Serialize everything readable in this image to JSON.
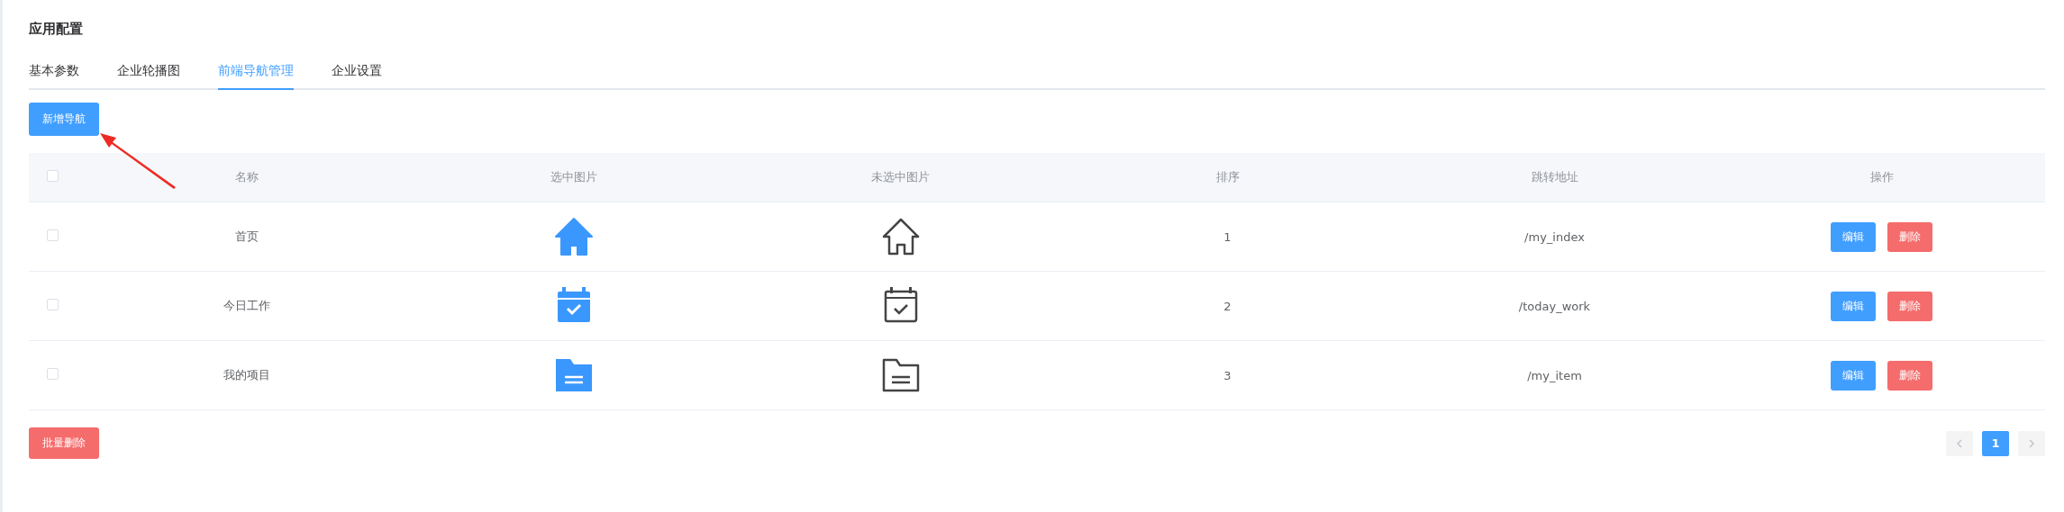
{
  "title": "应用配置",
  "tabs": [
    {
      "label": "基本参数",
      "selected": false
    },
    {
      "label": "企业轮播图",
      "selected": false
    },
    {
      "label": "前端导航管理",
      "selected": true
    },
    {
      "label": "企业设置",
      "selected": false
    }
  ],
  "add_button": "新增导航",
  "table": {
    "select_all": {
      "checked": false
    },
    "columns": [
      "名称",
      "选中图片",
      "未选中图片",
      "排序",
      "跳转地址",
      "操作"
    ],
    "rows": [
      {
        "checked": false,
        "name": "首页",
        "kind": "home",
        "order": "1",
        "path": "/my_index",
        "edit": "编辑",
        "delete": "删除"
      },
      {
        "checked": false,
        "name": "今日工作",
        "kind": "calendar",
        "order": "2",
        "path": "/today_work",
        "edit": "编辑",
        "delete": "删除"
      },
      {
        "checked": false,
        "name": "我的项目",
        "kind": "folder",
        "order": "3",
        "path": "/my_item",
        "edit": "编辑",
        "delete": "删除"
      }
    ]
  },
  "batch_delete": "批量删除",
  "pagination": {
    "pages": [
      {
        "label": "1",
        "selected": true
      }
    ]
  }
}
